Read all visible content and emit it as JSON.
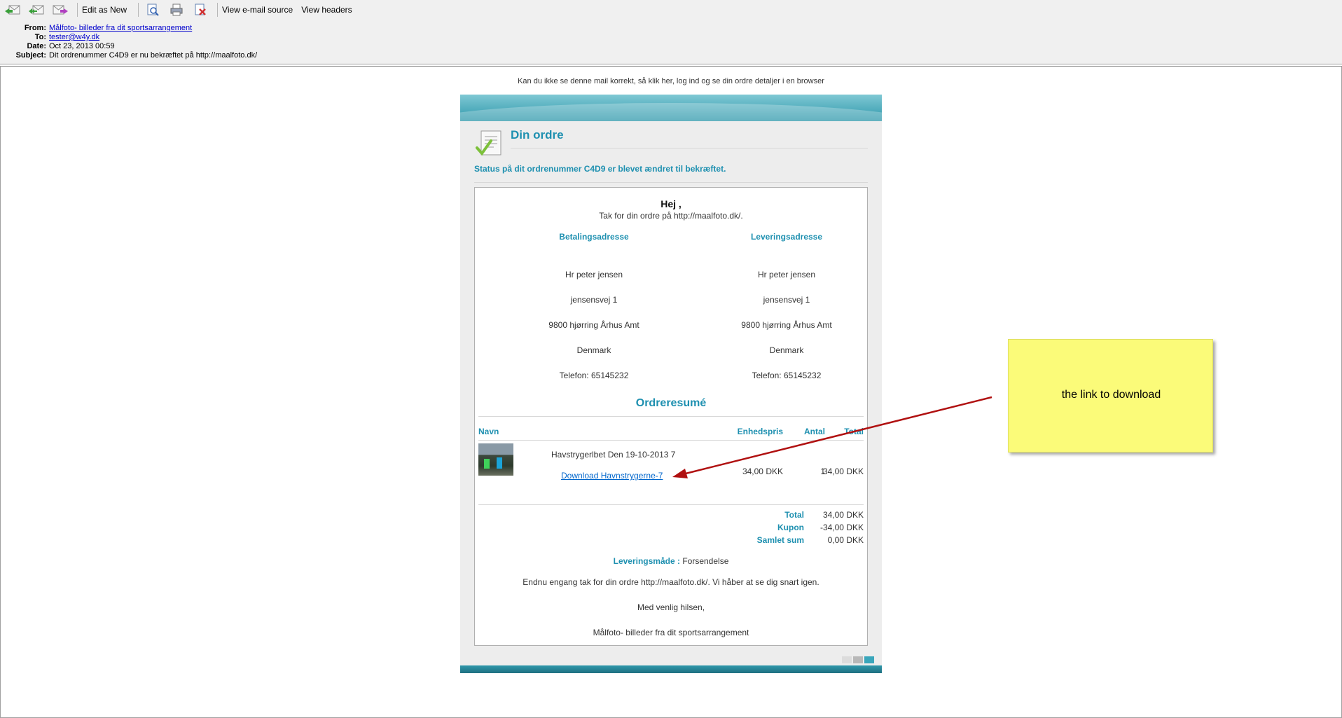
{
  "toolbar": {
    "edit_as_new": "Edit as New",
    "view_source": "View e-mail source",
    "view_headers": "View headers"
  },
  "header": {
    "from_label": "From:",
    "from_value": "Målfoto- billeder fra dit sportsarrangement",
    "to_label": "To:",
    "to_value": "tester@w4y.dk",
    "date_label": "Date:",
    "date_value": "Oct 23, 2013 00:59",
    "subject_label": "Subject:",
    "subject_value": "Dit ordrenummer C4D9 er nu bekræftet på http://maalfoto.dk/"
  },
  "email": {
    "top_note": "Kan du ikke se denne mail korrekt, så klik her, log ind og se din ordre detaljer i en browser",
    "title": "Din ordre",
    "status": "Status på dit ordrenummer C4D9 er blevet ændret til bekræftet.",
    "greeting": "Hej ,",
    "thanks": "Tak for din ordre på http://maalfoto.dk/.",
    "billing": {
      "heading": "Betalingsadresse",
      "name": "Hr peter jensen",
      "street": "jensensvej 1",
      "city": "9800 hjørring Århus Amt",
      "country": "Denmark",
      "phone": "Telefon: 65145232"
    },
    "shipping": {
      "heading": "Leveringsadresse",
      "name": "Hr peter jensen",
      "street": "jensensvej 1",
      "city": "9800 hjørring Århus Amt",
      "country": "Denmark",
      "phone": "Telefon: 65145232"
    },
    "summary_heading": "Ordreresumé",
    "columns": {
      "name": "Navn",
      "unit_price": "Enhedspris",
      "qty": "Antal",
      "total": "Total"
    },
    "item": {
      "name": "Havstrygerlbet Den 19-10-2013 7",
      "link": "Download Havnstrygerne-7",
      "unit_price": "34,00 DKK",
      "qty": "1",
      "total": "34,00 DKK"
    },
    "totals": {
      "total_label": "Total",
      "total_value": "34,00 DKK",
      "coupon_label": "Kupon",
      "coupon_value": "-34,00 DKK",
      "sum_label": "Samlet sum",
      "sum_value": "0,00 DKK"
    },
    "delivery_label": "Leveringsmåde :",
    "delivery_value": "Forsendelse",
    "closing": "Endnu engang tak for din ordre http://maalfoto.dk/. Vi håber at se dig snart igen.",
    "regards": "Med venlig hilsen,",
    "signature": "Målfoto- billeder fra dit sportsarrangement"
  },
  "annotation": {
    "note_text": "the link  to download",
    "arrow_color": "#b01010",
    "note_color": "#fbfb79"
  },
  "colors": {
    "accent": "#1e90b0",
    "banner": "#2f98ab",
    "link": "#0066cc"
  },
  "icons": [
    "reply-icon",
    "reply-all-icon",
    "forward-icon",
    "preview-icon",
    "print-icon",
    "delete-icon",
    "document-check-icon"
  ]
}
